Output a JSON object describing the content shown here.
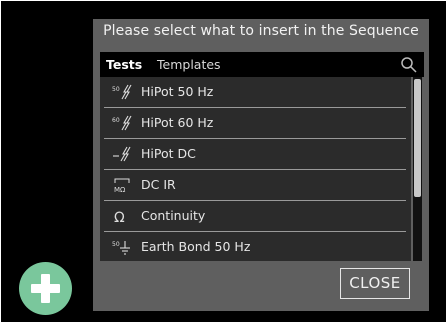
{
  "dialog": {
    "title": "Please select what to insert in the Sequence",
    "tabs": [
      {
        "label": "Tests",
        "active": true
      },
      {
        "label": "Templates",
        "active": false
      }
    ],
    "items": [
      {
        "label": "HiPot 50 Hz",
        "icon": "hipot-50hz-icon"
      },
      {
        "label": "HiPot 60 Hz",
        "icon": "hipot-60hz-icon"
      },
      {
        "label": "HiPot DC",
        "icon": "hipot-dc-icon"
      },
      {
        "label": "DC IR",
        "icon": "dc-ir-icon"
      },
      {
        "label": "Continuity",
        "icon": "continuity-icon"
      },
      {
        "label": "Earth Bond 50 Hz",
        "icon": "earth-bond-icon"
      }
    ],
    "close_label": "CLOSE"
  },
  "colors": {
    "dialog_bg": "#5f5f5f",
    "list_bg": "#2b2b2b",
    "fab": "#7ac79c"
  }
}
